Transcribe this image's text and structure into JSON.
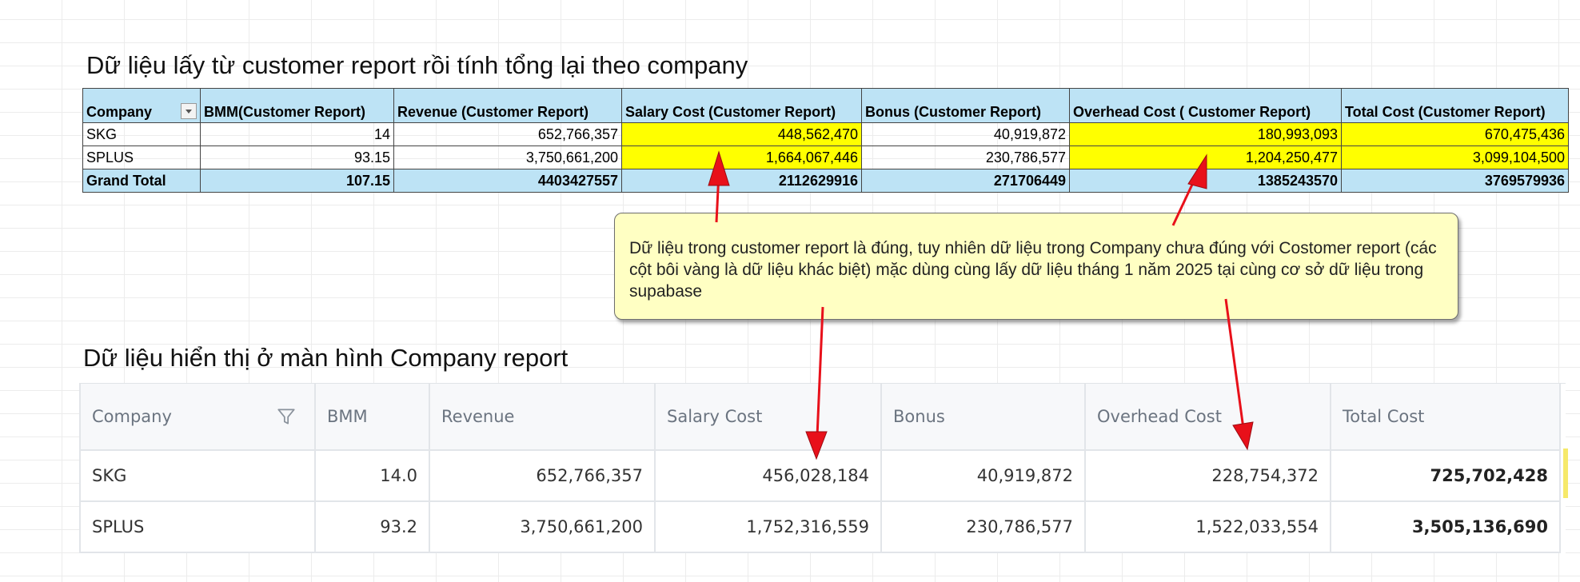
{
  "top_title": "Dữ liệu lấy từ customer report rồi tính tổng lại theo company",
  "bottom_title": "Dữ liệu hiển thị ở màn hình Company report",
  "pivot": {
    "headers": [
      "Company",
      "BMM(Customer Report)",
      "Revenue (Customer Report)",
      "Salary Cost (Customer Report)",
      "Bonus (Customer Report)",
      "Overhead Cost ( Customer Report)",
      "Total Cost (Customer Report)"
    ],
    "rows": [
      [
        "SKG",
        "14",
        "652,766,357",
        "448,562,470",
        "40,919,872",
        "180,993,093",
        "670,475,436"
      ],
      [
        "SPLUS",
        "93.15",
        "3,750,661,200",
        "1,664,067,446",
        "230,786,577",
        "1,204,250,477",
        "3,099,104,500"
      ]
    ],
    "total": [
      "Grand Total",
      "107.15",
      "4403427557",
      "2112629916",
      "271706449",
      "1385243570",
      "3769579936"
    ],
    "highlight_color": "#ffff00",
    "header_color": "#bde3f5"
  },
  "callout": {
    "text": "Dữ liệu trong customer report là đúng, tuy nhiên dữ liệu trong Company chưa đúng với Costomer report (các cột bôi vàng là dữ liệu khác biệt) mặc dùng cùng lấy dữ liệu tháng 1 năm 2025 tại cùng cơ sở dữ liệu trong supabase"
  },
  "company_report": {
    "headers": [
      "Company",
      "BMM",
      "Revenue",
      "Salary Cost",
      "Bonus",
      "Overhead Cost",
      "Total Cost"
    ],
    "rows": [
      [
        "SKG",
        "14.0",
        "652,766,357",
        "456,028,184",
        "40,919,872",
        "228,754,372",
        "725,702,428"
      ],
      [
        "SPLUS",
        "93.2",
        "3,750,661,200",
        "1,752,316,559",
        "230,786,577",
        "1,522,033,554",
        "3,505,136,690"
      ]
    ],
    "filter_icon": "funnel-icon"
  },
  "arrow_color": "#e8101a"
}
